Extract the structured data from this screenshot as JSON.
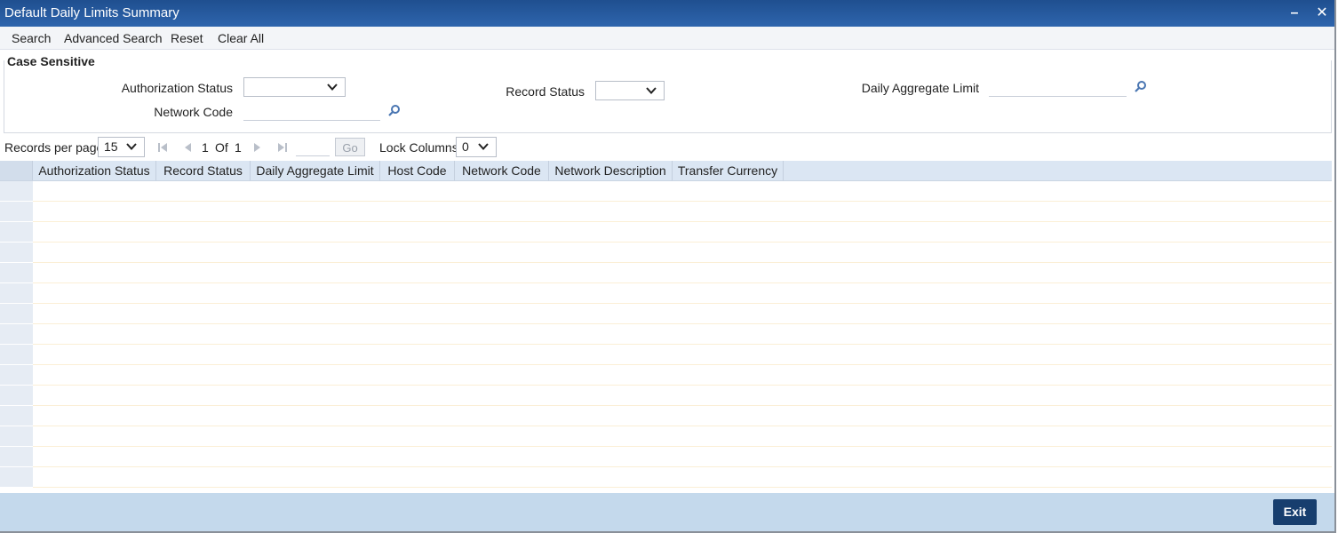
{
  "window": {
    "title": "Default Daily Limits Summary"
  },
  "toolbar": {
    "search": "Search",
    "advanced_search": "Advanced Search",
    "reset": "Reset",
    "clear_all": "Clear All"
  },
  "criteria": {
    "legend": "Case Sensitive",
    "authorization_status_label": "Authorization Status",
    "authorization_status_value": "",
    "network_code_label": "Network Code",
    "network_code_value": "",
    "record_status_label": "Record Status",
    "record_status_value": "",
    "daily_aggregate_limit_label": "Daily Aggregate Limit",
    "daily_aggregate_limit_value": ""
  },
  "pager": {
    "records_per_page_label": "Records per page",
    "records_per_page": "15",
    "current_page": "1",
    "of_label": "Of",
    "total_pages": "1",
    "go_label": "Go",
    "lock_columns_label": "Lock Columns",
    "lock_columns": "0"
  },
  "grid": {
    "columns": [
      "Authorization Status",
      "Record Status",
      "Daily Aggregate Limit",
      "Host Code",
      "Network Code",
      "Network Description",
      "Transfer Currency"
    ],
    "row_count": 15
  },
  "footer": {
    "exit_label": "Exit"
  },
  "colors": {
    "title_bar": "#2a5da0",
    "footer": "#c4d9ec",
    "exit_button": "#173e6e",
    "grid_header": "#dbe6f3"
  },
  "icons": [
    "minimize-icon",
    "close-icon",
    "chevron-down-icon",
    "search-lookup-icon",
    "first-page-icon",
    "previous-page-icon",
    "next-page-icon",
    "last-page-icon"
  ]
}
